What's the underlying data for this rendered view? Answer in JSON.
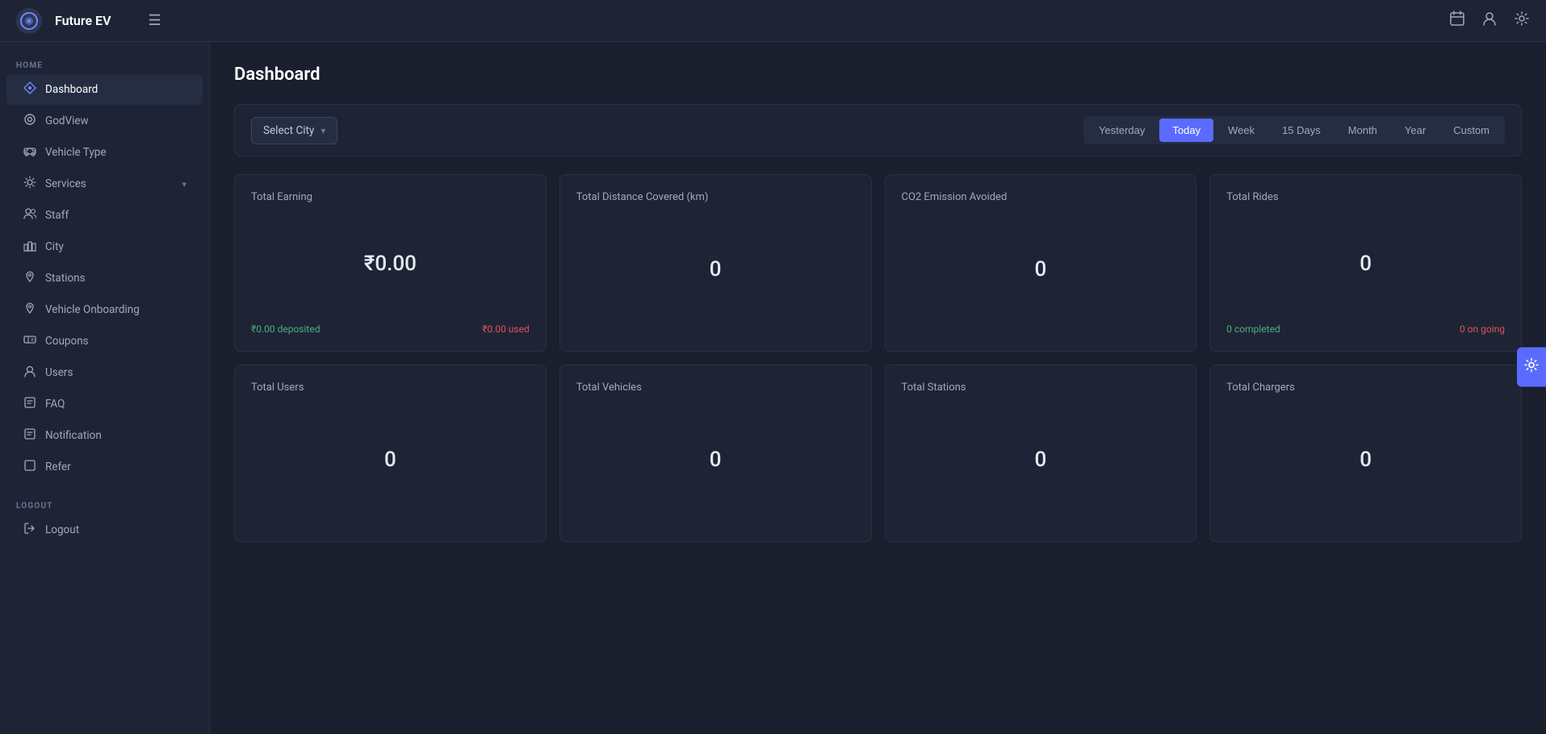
{
  "app": {
    "name": "Future EV",
    "logo_symbol": "🛡"
  },
  "topnav": {
    "hamburger_label": "☰",
    "icons": {
      "calendar": "📅",
      "user": "👤",
      "settings": "⚙"
    }
  },
  "sidebar": {
    "home_section_label": "HOME",
    "logout_section_label": "LOGOUT",
    "items": [
      {
        "id": "dashboard",
        "label": "Dashboard",
        "icon": "⬡",
        "active": true
      },
      {
        "id": "godview",
        "label": "GodView",
        "icon": "◉",
        "active": false
      },
      {
        "id": "vehicle-type",
        "label": "Vehicle Type",
        "icon": "🚌",
        "active": false
      },
      {
        "id": "services",
        "label": "Services",
        "icon": "🔧",
        "active": false,
        "has_arrow": true
      },
      {
        "id": "staff",
        "label": "Staff",
        "icon": "👥",
        "active": false
      },
      {
        "id": "city",
        "label": "City",
        "icon": "⊞",
        "active": false
      },
      {
        "id": "stations",
        "label": "Stations",
        "icon": "📍",
        "active": false
      },
      {
        "id": "vehicle-onboarding",
        "label": "Vehicle Onboarding",
        "icon": "📍",
        "active": false
      },
      {
        "id": "coupons",
        "label": "Coupons",
        "icon": "⊡",
        "active": false
      },
      {
        "id": "users",
        "label": "Users",
        "icon": "👤",
        "active": false
      },
      {
        "id": "faq",
        "label": "FAQ",
        "icon": "📋",
        "active": false
      },
      {
        "id": "notification",
        "label": "Notification",
        "icon": "⊡",
        "active": false
      },
      {
        "id": "refer",
        "label": "Refer",
        "icon": "⊡",
        "active": false
      }
    ],
    "logout_item": {
      "id": "logout",
      "label": "Logout",
      "icon": "↪"
    }
  },
  "page": {
    "title": "Dashboard"
  },
  "filter": {
    "city_placeholder": "Select City",
    "time_buttons": [
      {
        "id": "yesterday",
        "label": "Yesterday",
        "active": false
      },
      {
        "id": "today",
        "label": "Today",
        "active": true
      },
      {
        "id": "week",
        "label": "Week",
        "active": false
      },
      {
        "id": "15days",
        "label": "15 Days",
        "active": false
      },
      {
        "id": "month",
        "label": "Month",
        "active": false
      },
      {
        "id": "year",
        "label": "Year",
        "active": false
      },
      {
        "id": "custom",
        "label": "Custom",
        "active": false
      }
    ]
  },
  "stats": {
    "row1": [
      {
        "id": "total-earning",
        "title": "Total Earning",
        "value": "₹0.00",
        "footer_left": "₹0.00 deposited",
        "footer_right": "₹0.00 used",
        "footer_left_color": "green",
        "footer_right_color": "red"
      },
      {
        "id": "total-distance",
        "title": "Total Distance Covered (km)",
        "value": "0",
        "footer_left": "",
        "footer_right": ""
      },
      {
        "id": "co2-emission",
        "title": "CO2 Emission Avoided",
        "value": "0",
        "footer_left": "",
        "footer_right": ""
      },
      {
        "id": "total-rides",
        "title": "Total Rides",
        "value": "0",
        "footer_left": "0 completed",
        "footer_right": "0 on going",
        "footer_left_color": "green",
        "footer_right_color": "red"
      }
    ],
    "row2": [
      {
        "id": "total-users",
        "title": "Total Users",
        "value": "0",
        "footer_left": "",
        "footer_right": ""
      },
      {
        "id": "total-vehicles",
        "title": "Total Vehicles",
        "value": "0",
        "footer_left": "",
        "footer_right": ""
      },
      {
        "id": "total-stations",
        "title": "Total Stations",
        "value": "0",
        "footer_left": "",
        "footer_right": ""
      },
      {
        "id": "total-chargers",
        "title": "Total Chargers",
        "value": "0",
        "footer_left": "",
        "footer_right": ""
      }
    ]
  }
}
